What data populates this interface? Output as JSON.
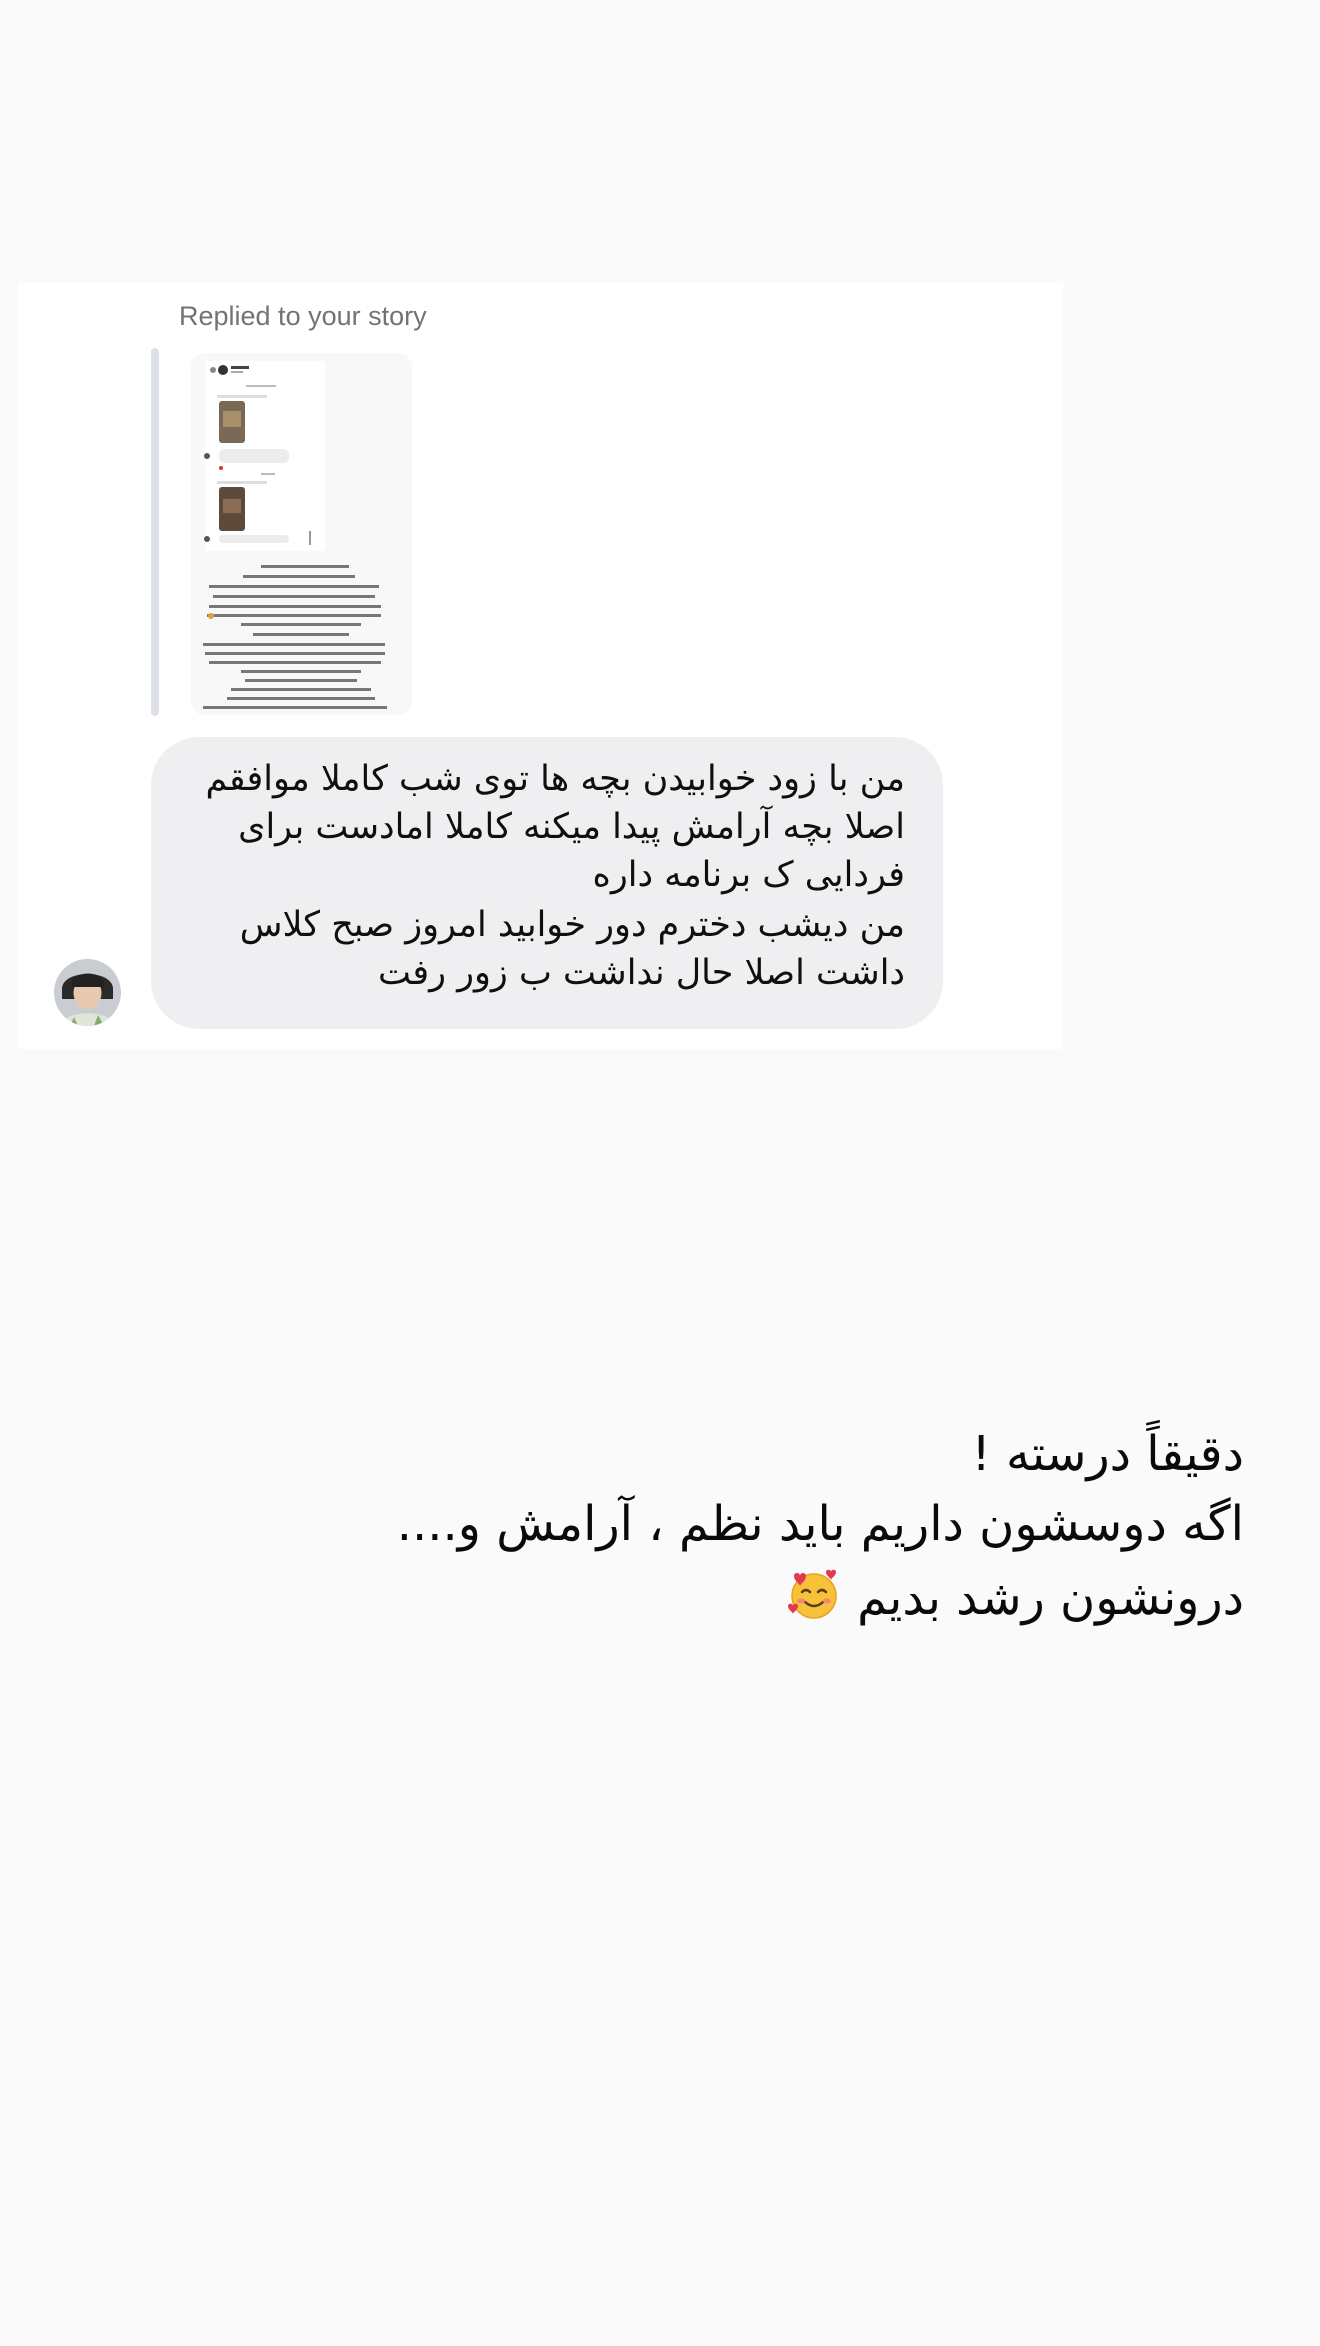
{
  "reply_label": "Replied to your story",
  "message": {
    "line1": "من با زود خوابیدن بچه ها توی شب کاملا موافقم",
    "line2": "اصلا بچه آرامش پیدا میکنه کاملا امادست برای",
    "line3": "فردایی ک برنامه داره",
    "line4": "من دیشب دخترم دور خوابید امروز صبح کلاس",
    "line5": "داشت اصلا حال نداشت ب زور رفت"
  },
  "caption": {
    "line1": "دقیقاً درسته !",
    "line2": "اگه دوسشون داریم باید نظم ، آرامش و....",
    "line3": "درونشون رشد بدیم",
    "emoji": "🥰"
  },
  "colors": {
    "background": "#fafafa",
    "card": "#ffffff",
    "bubble": "#efeff1",
    "label": "#737373",
    "text": "#0f0f0f"
  },
  "icons": {
    "avatar": "user-avatar-photo",
    "story": "story-screenshot-thumbnail",
    "emoji": "smiling-face-with-hearts"
  }
}
